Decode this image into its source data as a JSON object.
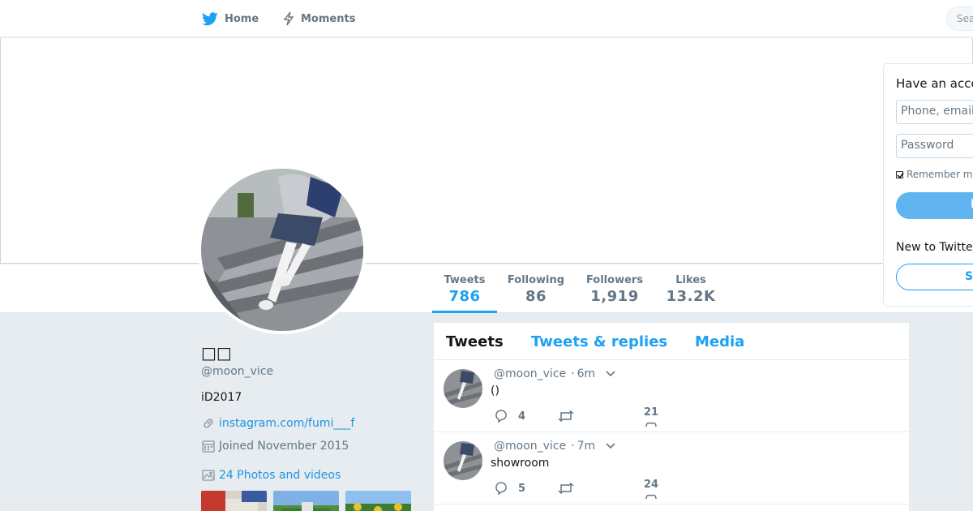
{
  "nav": {
    "home_label": "Home",
    "moments_label": "Moments",
    "search_placeholder": "Sea",
    "have_account_top": "Ha"
  },
  "profile": {
    "name": "□□",
    "handle": "@moon_vice",
    "bio": "iD2017",
    "link": "instagram.com/fumi___f",
    "joined": "Joined November 2015",
    "photos_label": "24 Photos and videos"
  },
  "stats": [
    {
      "label": "Tweets",
      "value": "786"
    },
    {
      "label": "Following",
      "value": "86"
    },
    {
      "label": "Followers",
      "value": "1,919"
    },
    {
      "label": "Likes",
      "value": "13.2K"
    }
  ],
  "timeline": {
    "tabs": [
      {
        "label": "Tweets"
      },
      {
        "label": "Tweets & replies"
      },
      {
        "label": "Media"
      }
    ],
    "tweets": [
      {
        "handle": "@moon_vice",
        "time": "6m",
        "text": "()",
        "replies": "4",
        "retweets": "",
        "likes": "21"
      },
      {
        "handle": "@moon_vice",
        "time": "7m",
        "text": "showroom",
        "replies": "5",
        "retweets": "",
        "likes": "24"
      }
    ]
  },
  "login": {
    "title": "Have an acco",
    "phone_placeholder": "Phone, email",
    "password_placeholder": "Password",
    "remember_label": "Remember m",
    "login_button": "L",
    "new_to": "New to Twitte",
    "signup_button": "S"
  },
  "colors": {
    "accent": "#1da1f2",
    "background": "#e6ecf0",
    "muted": "#657786"
  },
  "icons": [
    "twitter-bird-icon",
    "moments-bolt-icon",
    "link-icon",
    "calendar-icon",
    "photo-icon",
    "reply-icon",
    "retweet-icon",
    "heart-icon",
    "chevron-down-icon"
  ]
}
